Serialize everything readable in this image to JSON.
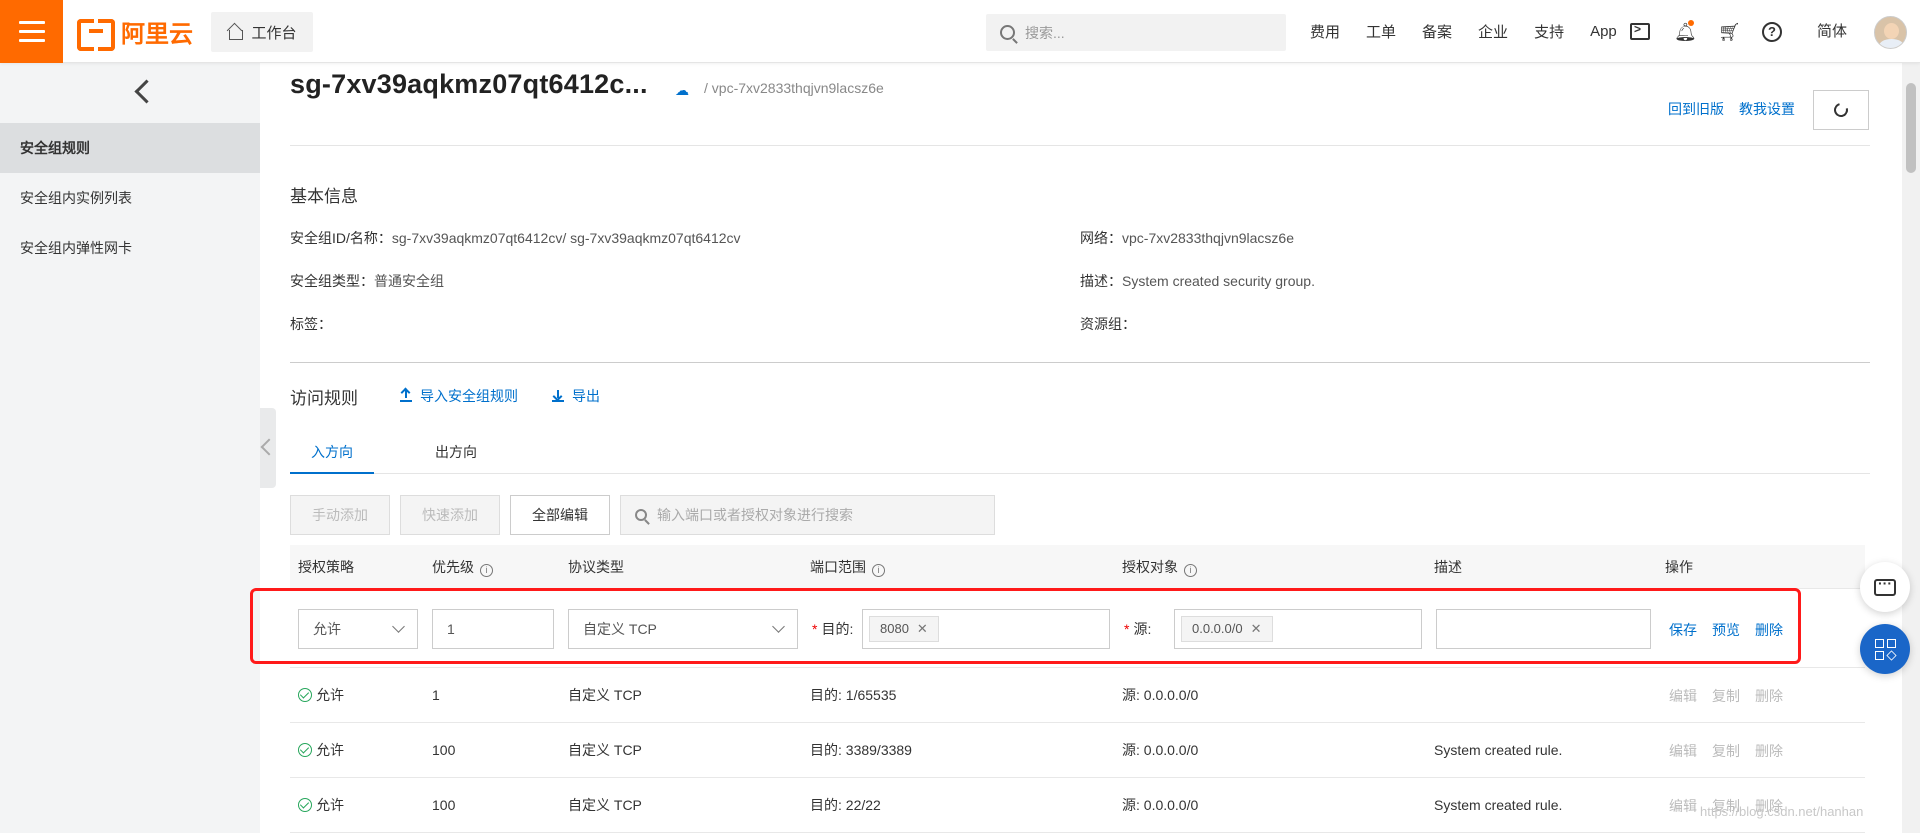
{
  "header": {
    "logo_text": "阿里云",
    "workbench_label": "工作台",
    "search_placeholder": "搜索...",
    "nav_links": [
      "费用",
      "工单",
      "备案",
      "企业",
      "支持",
      "App"
    ],
    "language": "简体",
    "brand_color": "#ff6a00"
  },
  "sidebar": {
    "items": [
      {
        "label": "安全组规则",
        "active": true
      },
      {
        "label": "安全组内实例列表",
        "active": false
      },
      {
        "label": "安全组内弹性网卡",
        "active": false
      }
    ]
  },
  "page": {
    "title": "sg-7xv39aqkmz07qt6412c...",
    "vpc_subtitle": "/ vpc-7xv2833thqjvn9lacsz6e",
    "actions": [
      "回到旧版",
      "教我设置"
    ]
  },
  "basic_info": {
    "heading": "基本信息",
    "sg_id_label": "安全组ID/名称：",
    "sg_id_value": "sg-7xv39aqkmz07qt6412cv/ sg-7xv39aqkmz07qt6412cv",
    "network_label": "网络：",
    "network_value": "vpc-7xv2833thqjvn9lacsz6e",
    "type_label": "安全组类型：",
    "type_value": "普通安全组",
    "desc_label": "描述：",
    "desc_value": "System created security group.",
    "tag_label": "标签：",
    "resource_group_label": "资源组："
  },
  "access_rules": {
    "heading": "访问规则",
    "import_label": "导入安全组规则",
    "export_label": "导出",
    "tabs": [
      "入方向",
      "出方向"
    ],
    "buttons": {
      "manual_add": "手动添加",
      "quick_add": "快速添加",
      "edit_all": "全部编辑"
    },
    "search_placeholder": "输入端口或者授权对象进行搜索",
    "columns": [
      "授权策略",
      "优先级",
      "协议类型",
      "端口范围",
      "授权对象",
      "描述",
      "操作"
    ],
    "edit_row": {
      "policy": "允许",
      "priority": "1",
      "protocol": "自定义 TCP",
      "dest_label": "目的:",
      "port_tag": "8080",
      "source_label": "源:",
      "source_tag": "0.0.0.0/0",
      "description": "",
      "actions": [
        "保存",
        "预览",
        "删除"
      ]
    },
    "rows": [
      {
        "policy": "允许",
        "priority": "1",
        "protocol": "自定义 TCP",
        "port": "目的: 1/65535",
        "source": "源: 0.0.0.0/0",
        "description": ""
      },
      {
        "policy": "允许",
        "priority": "100",
        "protocol": "自定义 TCP",
        "port": "目的: 3389/3389",
        "source": "源: 0.0.0.0/0",
        "description": "System created rule."
      },
      {
        "policy": "允许",
        "priority": "100",
        "protocol": "自定义 TCP",
        "port": "目的: 22/22",
        "source": "源: 0.0.0.0/0",
        "description": "System created rule."
      }
    ],
    "row_actions": [
      "编辑",
      "复制",
      "删除"
    ]
  },
  "watermark": "https://blog.csdn.net/hanhan"
}
